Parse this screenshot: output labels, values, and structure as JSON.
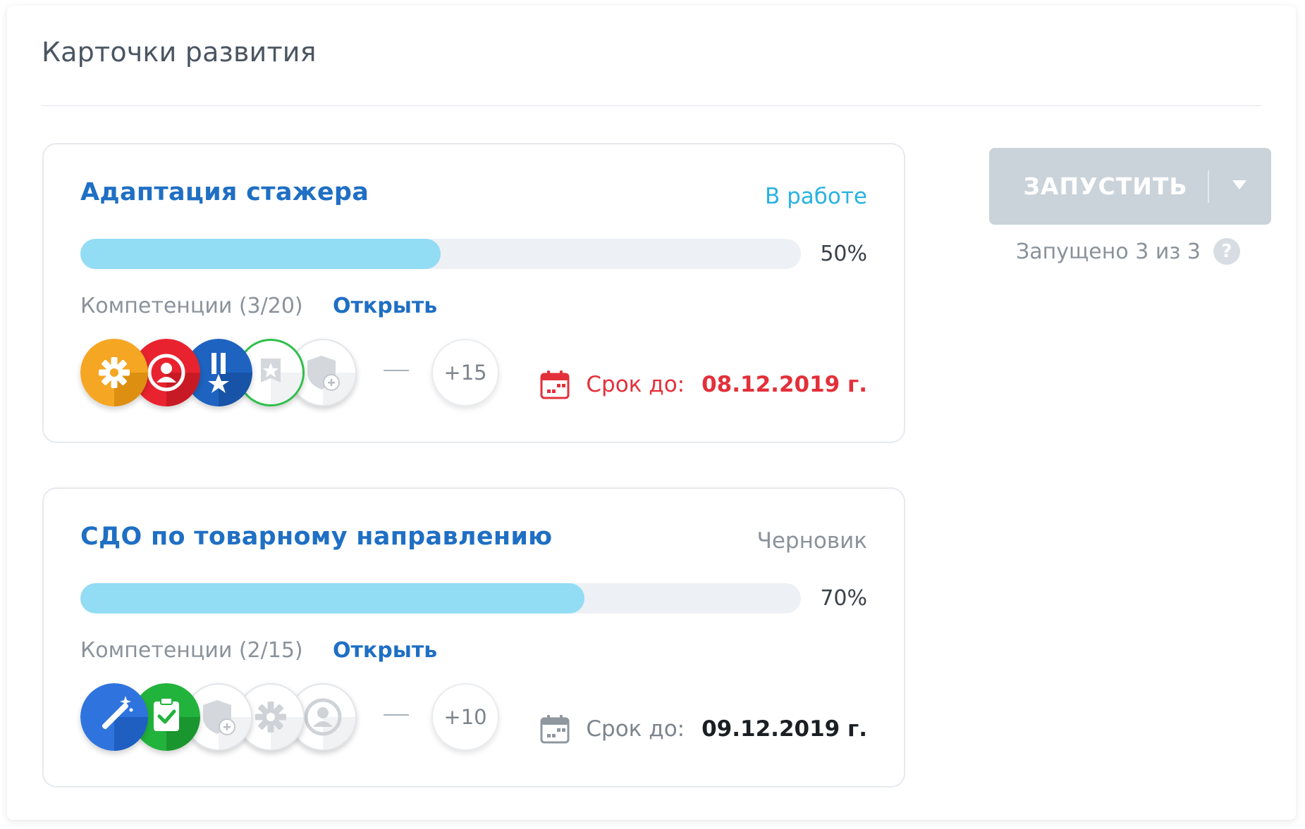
{
  "page": {
    "title": "Карточки развития"
  },
  "launch": {
    "label": "ЗАПУСТИТЬ",
    "note": "Запущено 3 из 3",
    "help": "?"
  },
  "cards": [
    {
      "title": "Адаптация стажера",
      "status": "В работе",
      "progress": 50,
      "progress_label": "50%",
      "competencies_label": "Компетенции (3/20)",
      "open_label": "Открыть",
      "more_label": "+15",
      "deadline_label": "Срок до:",
      "deadline_date": "08.12.2019 г.",
      "badges": [
        "gear-badge",
        "user-badge",
        "medal-badge",
        "star-badge-outlined",
        "shield-plus-badge-inactive"
      ]
    },
    {
      "title": "СДО по товарному направлению",
      "status": "Черновик",
      "progress": 70,
      "progress_label": "70%",
      "competencies_label": "Компетенции (2/15)",
      "open_label": "Открыть",
      "more_label": "+10",
      "deadline_label": "Срок до:",
      "deadline_date": "09.12.2019 г.",
      "badges": [
        "magic-wand-badge",
        "clipboard-check-badge",
        "shield-plus-badge-inactive",
        "gear-badge-inactive",
        "user-badge-inactive"
      ]
    }
  ],
  "colors": {
    "accent": "#1f6fc4",
    "status_active": "#29b2e3",
    "status_draft": "#8a929b",
    "progress_fill": "#92dcf4",
    "overdue": "#e3303a",
    "button_disabled": "#c9d3d9"
  }
}
